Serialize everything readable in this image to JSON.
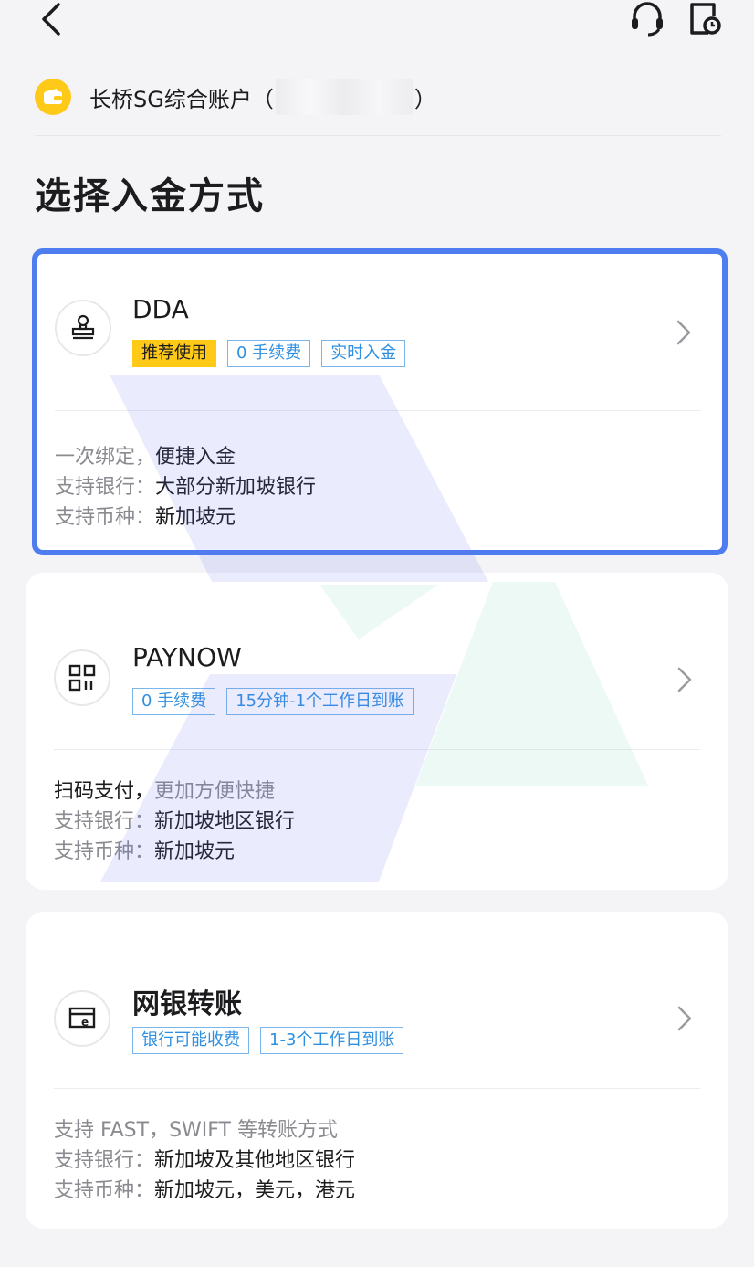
{
  "header": {
    "back_icon": "chevron-left-icon",
    "support_icon": "headset-icon",
    "history_icon": "document-clock-icon"
  },
  "account": {
    "icon": "wallet-icon",
    "name": "长桥SG综合账户",
    "paren_open": "（",
    "paren_close": "）"
  },
  "page_title": "选择入金方式",
  "methods": [
    {
      "title": "DDA",
      "icon": "stamp-icon",
      "tags": [
        "推荐使用",
        "0 手续费",
        "实时入金"
      ],
      "lines": [
        {
          "label": "一次绑定，",
          "value": "便捷入金"
        },
        {
          "label": "支持银行：",
          "value": "大部分新加坡银行"
        },
        {
          "label": "支持币种：",
          "value": "新加坡元"
        }
      ]
    },
    {
      "title": "PAYNOW",
      "icon": "qr-code-icon",
      "tags": [
        "0 手续费",
        "15分钟-1个工作日到账"
      ],
      "lines": [
        {
          "label": "扫码支付，",
          "value": "更加方便快捷"
        },
        {
          "label": "支持银行：",
          "value": "新加坡地区银行"
        },
        {
          "label": "支持币种：",
          "value": "新加坡元"
        }
      ]
    },
    {
      "title": "网银转账",
      "icon": "online-banking-icon",
      "tags": [
        "银行可能收费",
        "1-3个工作日到账"
      ],
      "lines": [
        {
          "label": "支持 FAST，SWIFT 等转账方式",
          "value": ""
        },
        {
          "label": "支持银行：",
          "value": "新加坡及其他地区银行"
        },
        {
          "label": "支持币种：",
          "value": "新加坡元，美元，港元"
        }
      ]
    }
  ],
  "colors": {
    "accent": "#4e7df0",
    "tag_hot": "#ffc917",
    "tag_border": "#7ab6ea",
    "tag_text": "#2f8fe0"
  }
}
